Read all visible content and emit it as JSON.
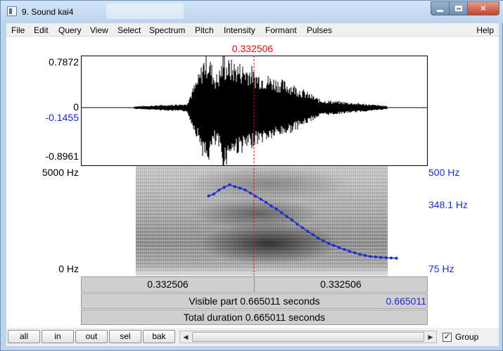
{
  "window": {
    "title": "9. Sound kai4"
  },
  "menu": {
    "items": [
      "File",
      "Edit",
      "Query",
      "View",
      "Select",
      "Spectrum",
      "Pitch",
      "Intensity",
      "Formant",
      "Pulses"
    ],
    "help": "Help"
  },
  "cursor": {
    "time": "0.332506"
  },
  "waveform": {
    "max_label": "0.7872",
    "zero_label": "0",
    "cursor_value_label": "-0.1455",
    "min_label": "-0.8961"
  },
  "spectrogram": {
    "freq_max_label": "5000 Hz",
    "freq_min_label": "0 Hz",
    "pitch_max_label": "500 Hz",
    "pitch_cursor_label": "348.1 Hz",
    "pitch_min_label": "75 Hz"
  },
  "time_bars": {
    "left_segment": "0.332506",
    "right_segment": "0.332506",
    "visible_start": "0",
    "visible_text": "Visible part 0.665011 seconds",
    "visible_end": "0.665011",
    "total_text": "Total duration 0.665011 seconds"
  },
  "buttons": {
    "all": "all",
    "in": "in",
    "out": "out",
    "sel": "sel",
    "bak": "bak"
  },
  "group": {
    "label": "Group",
    "checked": true,
    "check_glyph": "✓"
  },
  "colors": {
    "cursor": "#e01010",
    "pitch": "#1d2bd1"
  },
  "chart_data": {
    "type": "line",
    "series": [
      {
        "x": [
          0.245,
          0.255,
          0.265,
          0.275,
          0.285,
          0.295,
          0.305,
          0.315,
          0.325,
          0.335,
          0.345,
          0.355,
          0.365,
          0.375,
          0.385,
          0.395,
          0.405,
          0.415,
          0.425,
          0.435,
          0.445,
          0.455,
          0.465,
          0.475,
          0.485,
          0.495,
          0.505,
          0.515,
          0.525,
          0.535,
          0.545,
          0.555,
          0.565,
          0.575,
          0.585,
          0.595,
          0.605
        ],
        "values": [
          385,
          392,
          408,
          418,
          428,
          421,
          415,
          408,
          396,
          384,
          372,
          360,
          346,
          334,
          320,
          305,
          292,
          276,
          262,
          248,
          236,
          222,
          212,
          202,
          194,
          186,
          179,
          172,
          166,
          160,
          156,
          152,
          150,
          148,
          147,
          146,
          145
        ]
      }
    ],
    "ylim": [
      75,
      500
    ],
    "xlim": [
      0,
      0.665011
    ]
  }
}
